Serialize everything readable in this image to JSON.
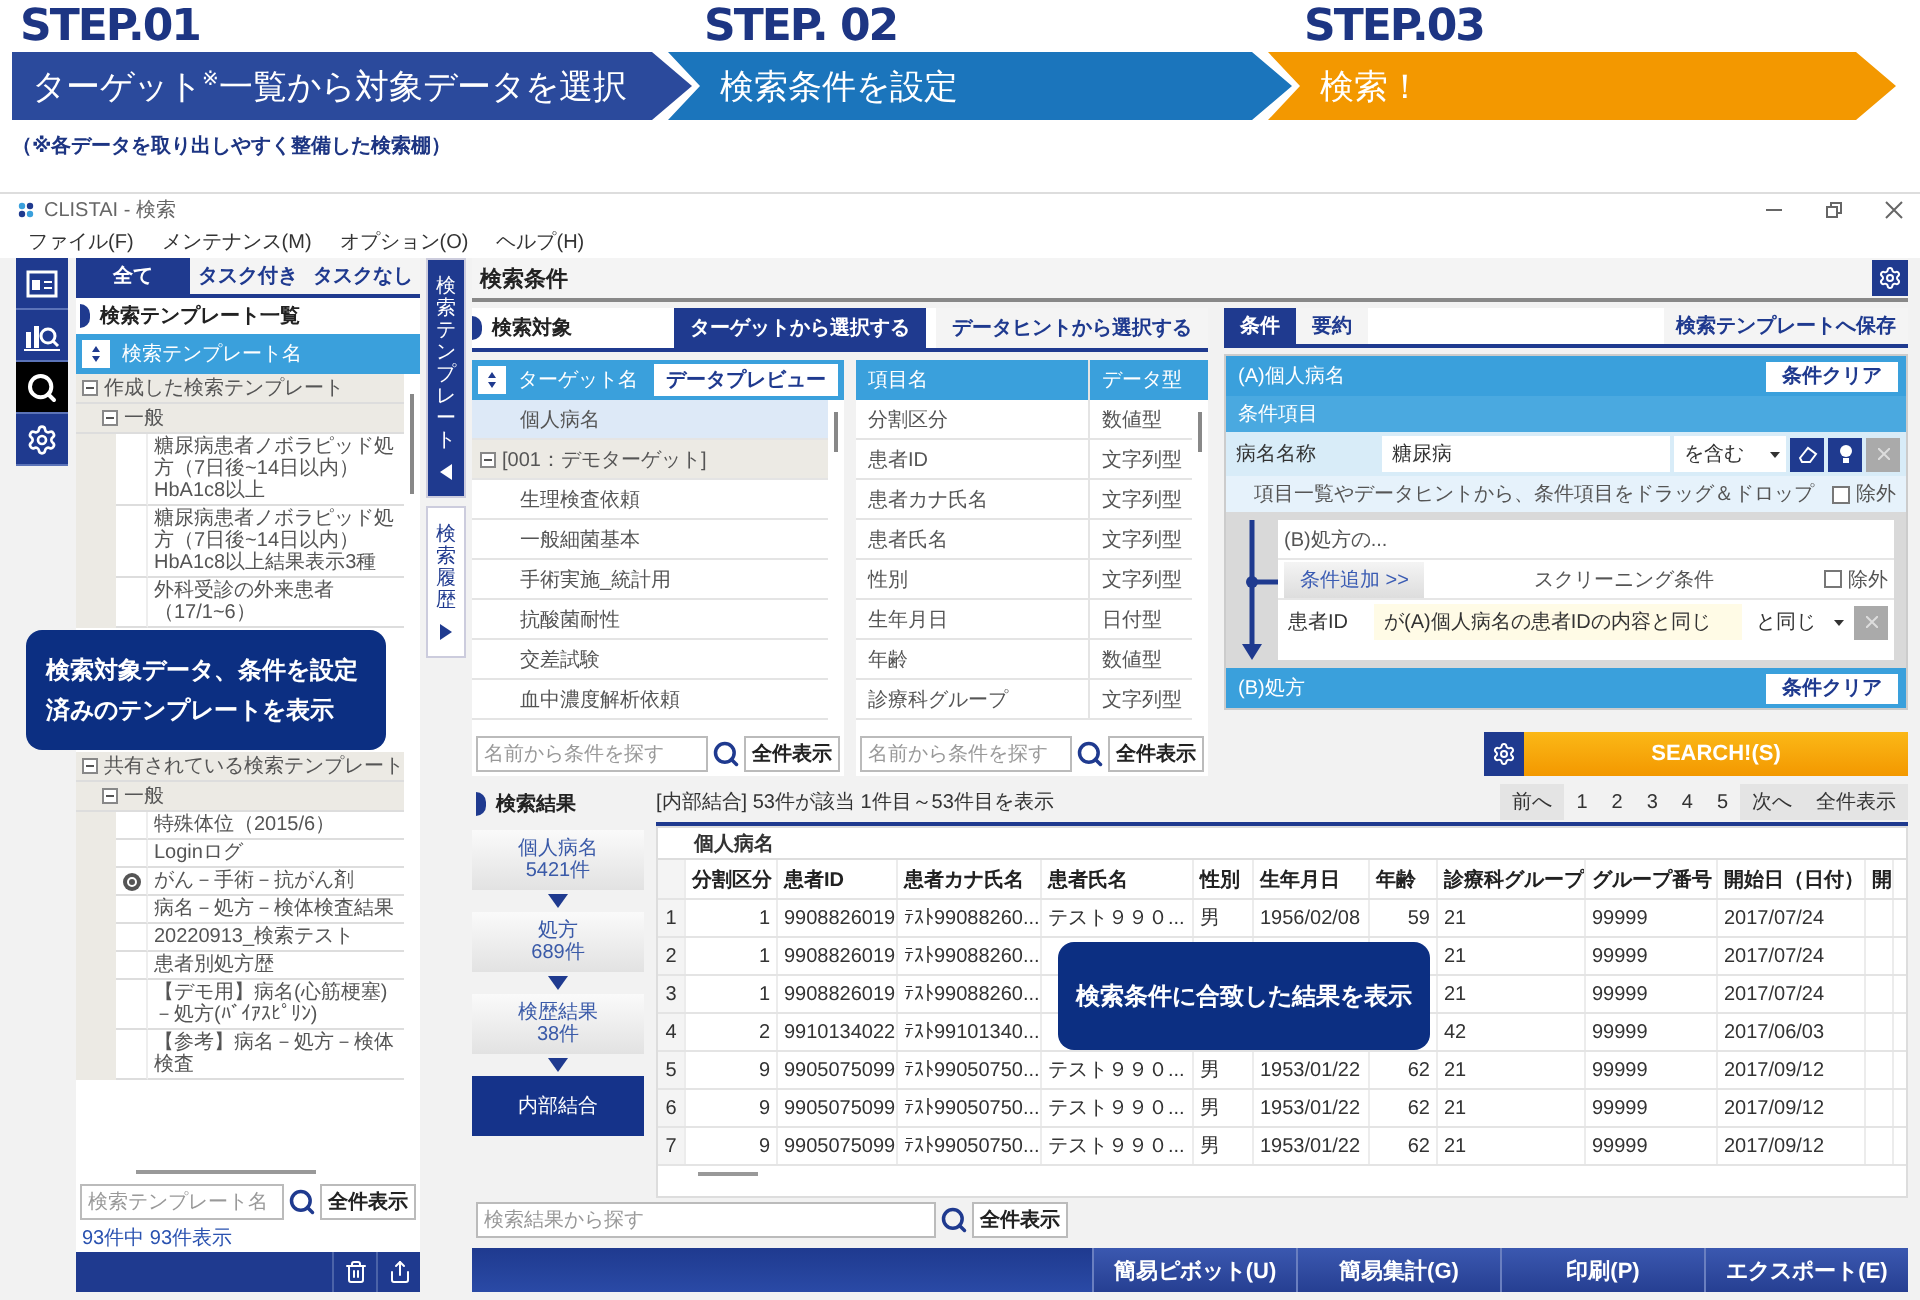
{
  "steps": [
    {
      "label": "STEP.01",
      "text": "ターゲット$^{※}$一覧から対象データを選択",
      "color": "#2b4a9c"
    },
    {
      "label": "STEP. 02",
      "text": "検索条件を設定",
      "color": "#1b75bc"
    },
    {
      "label": "STEP.03",
      "text": "検索！",
      "color": "#f39800"
    }
  ],
  "note": "（※各データを取り出しやすく整備した検索棚）",
  "window": {
    "title": "CLISTAI - 検索",
    "menu": [
      "ファイル(F)",
      "メンテナンス(M)",
      "オプション(O)",
      "ヘルプ(H)"
    ]
  },
  "icon_sidebar": [
    {
      "kind": "card",
      "selected": false
    },
    {
      "kind": "chart",
      "selected": false
    },
    {
      "kind": "search",
      "selected": true
    },
    {
      "kind": "gear",
      "selected": false
    }
  ],
  "left_panel": {
    "tabs": [
      {
        "label": "全て",
        "selected": true
      },
      {
        "label": "タスク付き",
        "selected": false
      },
      {
        "label": "タスクなし",
        "selected": false
      }
    ],
    "title": "検索テンプレート一覧",
    "column": "検索テンプレート名",
    "tree": [
      {
        "label": "作成した検索テンプレート",
        "expanded": true,
        "children": [
          {
            "label": "一般",
            "expanded": true,
            "children": [
              {
                "label": "糖尿病患者ノボラピッド処方（7日後~14日以内）HbA1c8以上",
                "linked": false
              },
              {
                "label": "糖尿病患者ノボラピッド処方（7日後~14日以内）HbA1c8以上結果表示3種",
                "linked": false
              },
              {
                "label": "外科受診の外来患者（17/1~6）",
                "linked": false
              }
            ]
          }
        ]
      },
      {
        "label": "共有されている検索テンプレート",
        "expanded": true,
        "children": [
          {
            "label": "一般",
            "expanded": true,
            "children": [
              {
                "label": "特殊体位（2015/6）",
                "linked": false
              },
              {
                "label": "Loginログ",
                "linked": false
              },
              {
                "label": "がん－手術－抗がん剤",
                "linked": true
              },
              {
                "label": "病名－処方－検体検査結果",
                "linked": false
              },
              {
                "label": "20220913_検索テスト",
                "linked": false
              },
              {
                "label": "患者別処方歴",
                "linked": false
              },
              {
                "label": "【デモ用】病名(心筋梗塞)－処方(ﾊﾞｲｱｽﾋﾟﾘﾝ)",
                "linked": false
              },
              {
                "label": "【参考】病名－処方－検体検査",
                "linked": false
              }
            ]
          }
        ]
      }
    ],
    "callout": "検索対象データ、条件を設定済みのテンプレートを表示",
    "search": {
      "placeholder": "検索テンプレート名",
      "button": "全件表示"
    },
    "count": "93件中 93件表示"
  },
  "vertical_tabs": [
    {
      "label": "検索テンプレート",
      "selected": true
    },
    {
      "label": "検索履歴",
      "selected": false
    }
  ],
  "main": {
    "title": "検索条件"
  },
  "target_section": {
    "title": "検索対象",
    "tabs": [
      {
        "label": "ターゲットから選択する",
        "selected": true
      },
      {
        "label": "データヒントから選択する",
        "selected": false
      }
    ],
    "targets": {
      "column": "ターゲット名",
      "preview": "データプレビュー",
      "rows": [
        {
          "kind": "item",
          "label": "個人病名",
          "selected": true
        },
        {
          "kind": "group",
          "label": "[001：デモターゲット]",
          "expanded": true
        },
        {
          "kind": "item",
          "label": "生理検査依頼",
          "selected": false
        },
        {
          "kind": "item",
          "label": "一般細菌基本",
          "selected": false
        },
        {
          "kind": "item",
          "label": "手術実施_統計用",
          "selected": false
        },
        {
          "kind": "item",
          "label": "抗酸菌耐性",
          "selected": false
        },
        {
          "kind": "item",
          "label": "交差試験",
          "selected": false
        },
        {
          "kind": "item",
          "label": "血中濃度解析依頼",
          "selected": false
        }
      ],
      "search": {
        "placeholder": "名前から条件を探す",
        "button": "全件表示"
      }
    },
    "fields": {
      "columns": [
        "項目名",
        "データ型"
      ],
      "rows": [
        {
          "name": "分割区分",
          "type": "数値型"
        },
        {
          "name": "患者ID",
          "type": "文字列型"
        },
        {
          "name": "患者カナ氏名",
          "type": "文字列型"
        },
        {
          "name": "患者氏名",
          "type": "文字列型"
        },
        {
          "name": "性別",
          "type": "文字列型"
        },
        {
          "name": "生年月日",
          "type": "日付型"
        },
        {
          "name": "年齢",
          "type": "数値型"
        },
        {
          "name": "診療科グループ",
          "type": "文字列型"
        }
      ],
      "search": {
        "placeholder": "名前から条件を探す",
        "button": "全件表示"
      }
    }
  },
  "conditions": {
    "tabs": [
      {
        "label": "条件",
        "selected": true
      },
      {
        "label": "要約",
        "selected": false
      }
    ],
    "save": "検索テンプレートへ保存",
    "block_a": {
      "title": "(A)個人病名",
      "clear": "条件クリア",
      "section": "条件項目",
      "row": {
        "label": "病名名称",
        "value": "糖尿病",
        "operator": "を含む"
      },
      "hint": "項目一覧やデータヒントから、条件項目をドラッグ＆ドロップ",
      "exclude": {
        "label": "除外",
        "checked": false
      }
    },
    "link": {
      "title": "(B)処方の...",
      "add": "条件追加 >>",
      "screening": "スクリーニング条件",
      "exclude": {
        "label": "除外",
        "checked": false
      },
      "row": {
        "label": "患者ID",
        "value": "が(A)個人病名の患者IDの内容と同じ",
        "operator": "と同じ"
      }
    },
    "block_b": {
      "title": "(B)処方",
      "clear": "条件クリア"
    },
    "search": "SEARCH!(S)"
  },
  "results": {
    "title": "検索結果",
    "flow": [
      {
        "label": "個人病名",
        "count": "5421件",
        "selected": false
      },
      {
        "label": "処方",
        "count": "689件",
        "selected": false
      },
      {
        "label": "検歴結果",
        "count": "38件",
        "selected": false
      },
      {
        "label": "内部結合",
        "selected": true
      }
    ],
    "summary": "[内部結合] 53件が該当 1件目～53件目を表示",
    "pager": {
      "prev": "前へ",
      "pages": [
        "1",
        "2",
        "3",
        "4",
        "5"
      ],
      "next": "次へ",
      "all": "全件表示"
    },
    "table": {
      "group": "個人病名",
      "columns": [
        "分割区分",
        "患者ID",
        "患者カナ氏名",
        "患者氏名",
        "性別",
        "生年月日",
        "年齢",
        "診療科グループ",
        "グループ番号",
        "開始日（日付）",
        "開"
      ],
      "rows": [
        {
          "num": "1",
          "cells": [
            "1",
            "9908826019",
            "ﾃｽﾄ99088260...",
            "テスト９９０...",
            "男",
            "1956/02/08",
            "59",
            "21",
            "99999",
            "2017/07/24"
          ]
        },
        {
          "num": "2",
          "cells": [
            "1",
            "9908826019",
            "ﾃｽﾄ99088260...",
            null,
            null,
            null,
            null,
            "21",
            "99999",
            "2017/07/24"
          ]
        },
        {
          "num": "3",
          "cells": [
            "1",
            "9908826019",
            "ﾃｽﾄ99088260...",
            null,
            null,
            null,
            null,
            "21",
            "99999",
            "2017/07/24"
          ]
        },
        {
          "num": "4",
          "cells": [
            "2",
            "9910134022",
            "ﾃｽﾄ99101340...",
            null,
            null,
            null,
            null,
            "42",
            "99999",
            "2017/06/03"
          ]
        },
        {
          "num": "5",
          "cells": [
            "9",
            "9905075099",
            "ﾃｽﾄ99050750...",
            "テスト９９０...",
            "男",
            "1953/01/22",
            "62",
            "21",
            "99999",
            "2017/09/12"
          ]
        },
        {
          "num": "6",
          "cells": [
            "9",
            "9905075099",
            "ﾃｽﾄ99050750...",
            "テスト９９０...",
            "男",
            "1953/01/22",
            "62",
            "21",
            "99999",
            "2017/09/12"
          ]
        },
        {
          "num": "7",
          "cells": [
            "9",
            "9905075099",
            "ﾃｽﾄ99050750...",
            "テスト９９０...",
            "男",
            "1953/01/22",
            "62",
            "21",
            "99999",
            "2017/09/12"
          ]
        }
      ]
    },
    "callout": "検索条件に合致した結果を表示",
    "search": {
      "placeholder": "検索結果から探す",
      "button": "全件表示"
    }
  },
  "footer": [
    "簡易ピボット(U)",
    "簡易集計(G)",
    "印刷(P)",
    "エクスポート(E)"
  ]
}
